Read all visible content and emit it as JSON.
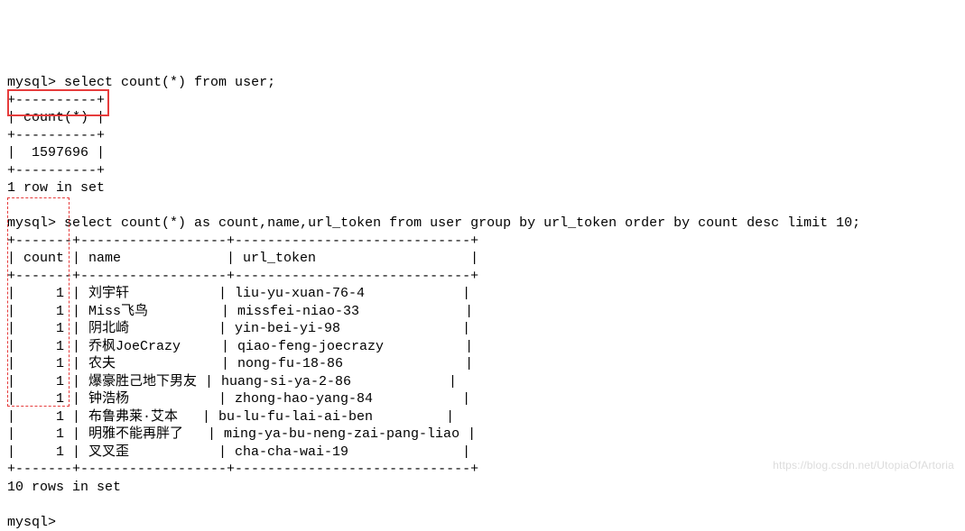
{
  "prompt": "mysql>",
  "query1": "select count(*) from user;",
  "border_count": "+----------+",
  "header_count": "| count(*) |",
  "count_value": "|  1597696 |",
  "result1_footer": "1 row in set",
  "query2": "select count(*) as count,name,url_token from user group by url_token order by count desc limit 10;",
  "border2": "+-------+------------------+-----------------------------+",
  "header2": "| count | name             | url_token                   |",
  "rows": [
    "|     1 | 刘宇轩           | liu-yu-xuan-76-4            |",
    "|     1 | Miss飞鸟         | missfei-niao-33             |",
    "|     1 | 阴北崎           | yin-bei-yi-98               |",
    "|     1 | 乔枫JoeCrazy     | qiao-feng-joecrazy          |",
    "|     1 | 农夫             | nong-fu-18-86               |",
    "|     1 | 爆豪胜己地下男友 | huang-si-ya-2-86            |",
    "|     1 | 钟浩杨           | zhong-hao-yang-84           |",
    "|     1 | 布鲁弗莱·艾本   | bu-lu-fu-lai-ai-ben         |",
    "|     1 | 明雅不能再胖了   | ming-ya-bu-neng-zai-pang-liao |",
    "|     1 | 叉叉歪           | cha-cha-wai-19              |"
  ],
  "result2_footer": "10 rows in set",
  "watermark": "https://blog.csdn.net/UtopiaOfArtoria",
  "chart_data": {
    "type": "table",
    "query1": {
      "sql": "select count(*) from user;",
      "columns": [
        "count(*)"
      ],
      "rows": [
        [
          1597696
        ]
      ],
      "footer": "1 row in set"
    },
    "query2": {
      "sql": "select count(*) as count,name,url_token from user group by url_token order by count desc limit 10;",
      "columns": [
        "count",
        "name",
        "url_token"
      ],
      "rows": [
        [
          1,
          "刘宇轩",
          "liu-yu-xuan-76-4"
        ],
        [
          1,
          "Miss飞鸟",
          "missfei-niao-33"
        ],
        [
          1,
          "阴北崎",
          "yin-bei-yi-98"
        ],
        [
          1,
          "乔枫JoeCrazy",
          "qiao-feng-joecrazy"
        ],
        [
          1,
          "农夫",
          "nong-fu-18-86"
        ],
        [
          1,
          "爆豪胜己地下男友",
          "huang-si-ya-2-86"
        ],
        [
          1,
          "钟浩杨",
          "zhong-hao-yang-84"
        ],
        [
          1,
          "布鲁弗莱·艾本",
          "bu-lu-fu-lai-ai-ben"
        ],
        [
          1,
          "明雅不能再胖了",
          "ming-ya-bu-neng-zai-pang-liao"
        ],
        [
          1,
          "叉叉歪",
          "cha-cha-wai-19"
        ]
      ],
      "footer": "10 rows in set"
    }
  }
}
